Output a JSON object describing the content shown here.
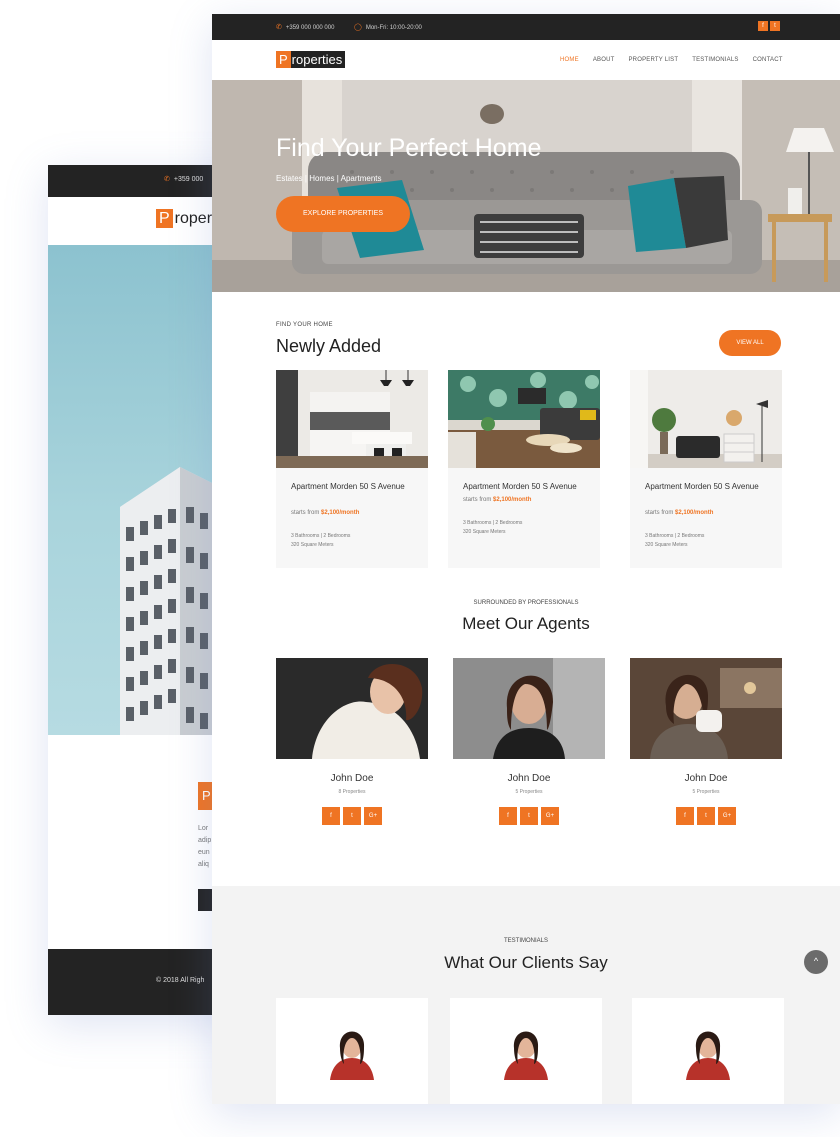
{
  "back": {
    "phone": "+359 000",
    "logo_first": "P",
    "logo_rest": "roper",
    "box_letter": "P",
    "text_lines": [
      "Lor",
      "adip",
      "eun",
      "aliq"
    ],
    "copyright": "© 2018 All Righ"
  },
  "front": {
    "topbar": {
      "phone": "+359 000 000 000",
      "hours": "Mon-Fri: 10:00-20:00",
      "social": [
        "f",
        "t"
      ]
    },
    "logo": {
      "first": "P",
      "rest": "roperties"
    },
    "menu": [
      "HOME",
      "ABOUT",
      "PROPERTY LIST",
      "TESTIMONIALS",
      "CONTACT"
    ],
    "hero": {
      "title": "Find Your Perfect Home",
      "subtitle": "Estates | Homes | Apartments",
      "button": "EXPLORE PROPERTIES"
    },
    "newly": {
      "eyebrow": "FIND YOUR HOME",
      "title": "Newly Added",
      "view_all": "VIEW ALL",
      "cards": [
        {
          "name": "Apartment Morden 50 S Avenue",
          "price_prefix": "starts from",
          "price": "$2,100/month",
          "specs1": "3 Bathrooms   |   2 Bedrooms",
          "specs2": "320 Square Meters"
        },
        {
          "name": "Apartment Morden 50 S Avenue",
          "price_prefix": "starts from",
          "price": "$2,100/month",
          "specs1": "3 Bathrooms   |   2 Bedrooms",
          "specs2": "320 Square Meters"
        },
        {
          "name": "Apartment Morden 50 S Avenue",
          "price_prefix": "starts from",
          "price": "$2,100/month",
          "specs1": "3 Bathrooms   |   2 Bedrooms",
          "specs2": "320 Square Meters"
        }
      ]
    },
    "agents": {
      "eyebrow": "SURROUNDED BY PROFESSIONALS",
      "title": "Meet Our Agents",
      "list": [
        {
          "name": "John Doe",
          "props": "8 Properties"
        },
        {
          "name": "John Doe",
          "props": "5 Properties"
        },
        {
          "name": "John Doe",
          "props": "5 Properties"
        }
      ],
      "social": [
        "f",
        "t",
        "G+"
      ]
    },
    "testimonials": {
      "eyebrow": "TESTIMONIALS",
      "title": "What Our Clients Say",
      "scroll_top": "^"
    }
  },
  "colors": {
    "accent": "#ef7423",
    "dark": "#232323",
    "light_bg": "#f3f3f3"
  }
}
